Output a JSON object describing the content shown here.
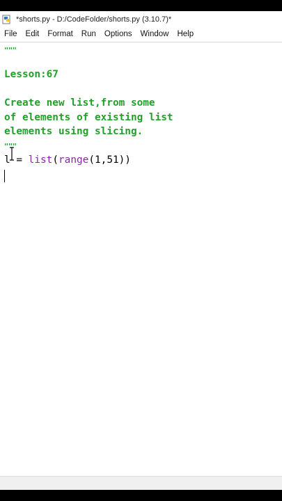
{
  "window": {
    "title": "*shorts.py - D:/CodeFolder/shorts.py (3.10.7)*"
  },
  "menu": {
    "items": [
      "File",
      "Edit",
      "Format",
      "Run",
      "Options",
      "Window",
      "Help"
    ]
  },
  "editor": {
    "lines": [
      {
        "text": "\"\"\"",
        "color": "green"
      },
      {
        "text": "Lesson:67",
        "color": "green"
      },
      {
        "text": "",
        "color": "green"
      },
      {
        "text": "Create new list,from some",
        "color": "green"
      },
      {
        "text": "of elements of existing list",
        "color": "green"
      },
      {
        "text": "elements using slicing.",
        "color": "green"
      },
      {
        "text": "\"\"\"",
        "color": "green"
      }
    ],
    "code_line": {
      "var": "l",
      "op": " = ",
      "builtin1": "list",
      "open1": "(",
      "builtin2": "range",
      "args": "(1,51))"
    }
  },
  "colors": {
    "string": "#22a02a",
    "builtin": "#8b24a8",
    "text": "#000000"
  },
  "icons": {
    "app": "idle-python-file-icon",
    "cursor": "i-beam-text-cursor-icon"
  }
}
